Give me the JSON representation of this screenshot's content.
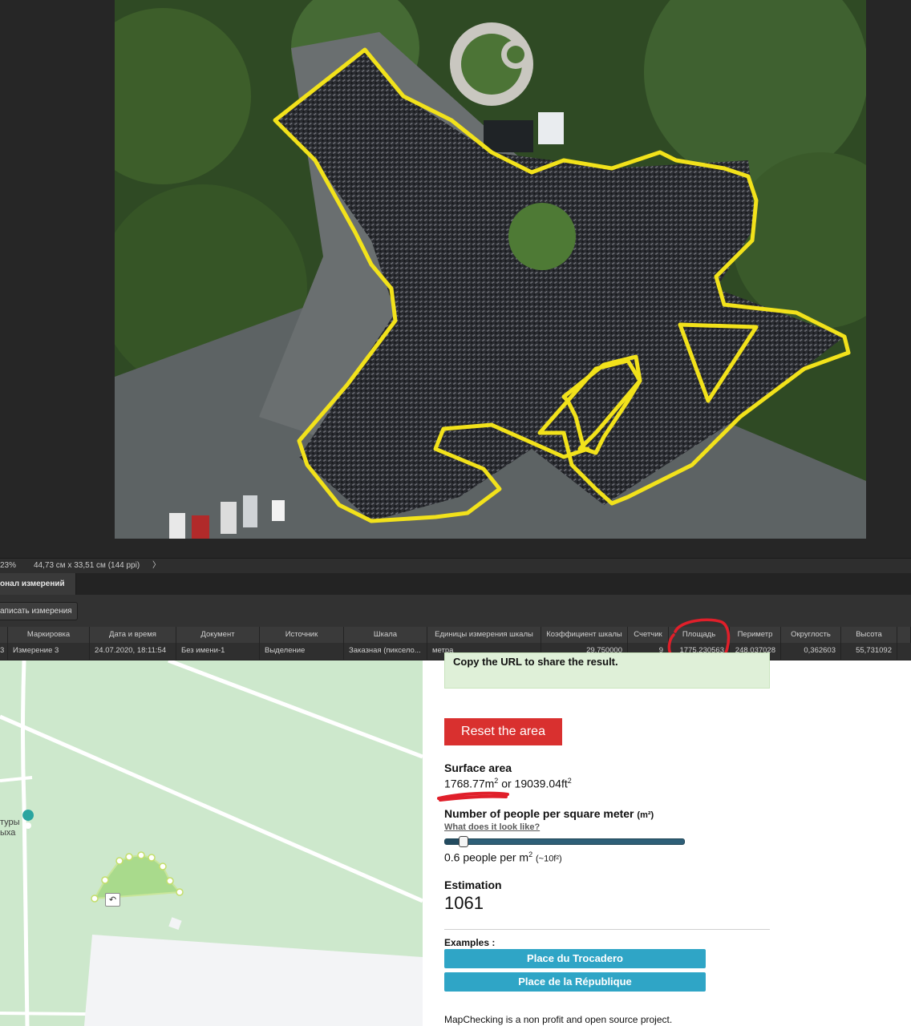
{
  "statusbar": {
    "zoom": "23%",
    "doc_size": "44,73 см x 33,51 см (144 ppi)",
    "arrow": "〉"
  },
  "panel": {
    "tab_label": "онал измерений",
    "record_button": "аписать измерения"
  },
  "measurements": {
    "columns": [
      "Маркировка",
      "Дата и время",
      "Документ",
      "Источник",
      "Шкала",
      "Единицы измерения шкалы",
      "Коэффициент шкалы",
      "Счетчик",
      "Площадь",
      "Периметр",
      "Округлость",
      "Высота"
    ],
    "row": {
      "index": "3",
      "cells": [
        "Измерение 3",
        "24.07.2020, 18:11:54",
        "Без имени-1",
        "Выделение",
        "Заказная (пиксело...",
        "метра",
        "29,750000",
        "9",
        "1775,230563",
        "248,037028",
        "0,362603",
        "55,731092"
      ]
    },
    "highlight_color": "#e01f2a"
  },
  "map": {
    "label_line1": "туры",
    "label_line2": "ыха",
    "undo_icon": "undo-icon"
  },
  "result": {
    "share_text": "Copy the URL to share the result.",
    "reset_label": "Reset the area",
    "surface_title": "Surface area",
    "surface_m2_value": "1768.77",
    "surface_m2_unit": "m",
    "surface_or": "or",
    "surface_ft2_value": "19039.04",
    "surface_ft2_unit": "ft",
    "exp": "2",
    "people_title": "Number of people per square meter",
    "people_unit": "(m²)",
    "look_link": "What does it look like?",
    "density_fraction": 0.06,
    "density_value": "0.6",
    "density_text": "people per m",
    "density_ft": "(~10f²)",
    "estimation_title": "Estimation",
    "estimation_value": "1061",
    "examples_title": "Examples :",
    "examples": [
      "Place du Trocadero",
      "Place de la République"
    ],
    "footer": "MapChecking is a non profit and open source project.",
    "reset_color": "#d9302f",
    "example_color": "#2fa5c6"
  }
}
